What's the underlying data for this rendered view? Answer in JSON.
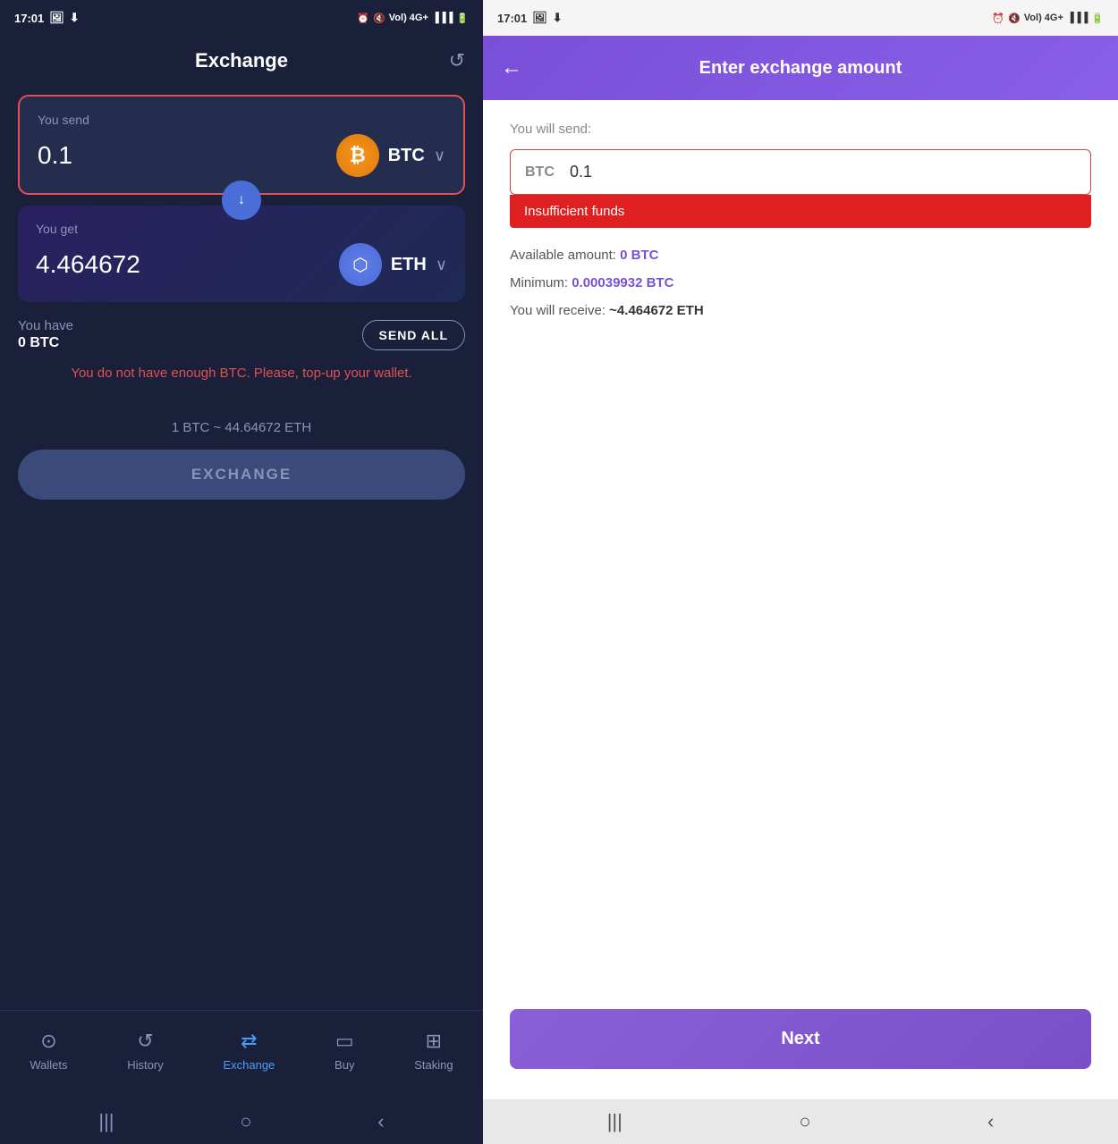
{
  "left": {
    "status_time": "17:01",
    "header_title": "Exchange",
    "send_label": "You send",
    "send_amount": "0.1",
    "send_crypto": "BTC",
    "get_label": "You get",
    "get_amount": "4.464672",
    "get_crypto": "ETH",
    "you_have_label": "You have",
    "you_have_amount": "0 BTC",
    "send_all_label": "SEND ALL",
    "error_message": "You do not have enough BTC. Please, top-up your wallet.",
    "rate_text": "1 BTC ~ 44.64672 ETH",
    "exchange_button_label": "EXCHANGE",
    "nav": {
      "wallets": "Wallets",
      "history": "History",
      "exchange": "Exchange",
      "buy": "Buy",
      "staking": "Staking"
    }
  },
  "right": {
    "status_time": "17:01",
    "header_title": "Enter exchange amount",
    "you_will_send_label": "You will send:",
    "currency": "BTC",
    "amount": "0.1",
    "insufficient_funds": "Insufficient funds",
    "available_label": "Available amount:",
    "available_amount": "0 BTC",
    "minimum_label": "Minimum:",
    "minimum_amount": "0.00039932 BTC",
    "receive_label": "You will receive:",
    "receive_amount": "~4.464672 ETH",
    "next_button_label": "Next"
  }
}
